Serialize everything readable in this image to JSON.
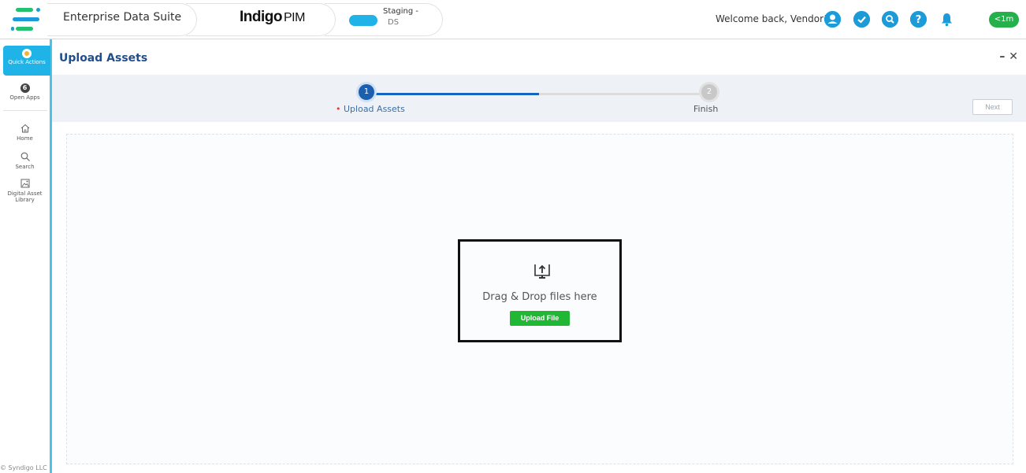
{
  "header": {
    "suite_name": "Enterprise Data Suite",
    "brand_main": "Indigo",
    "brand_suffix": "PIM",
    "env_line1": "Staging -",
    "env_line2": "DS",
    "welcome": "Welcome back, Vendor!",
    "time_badge": "<1m",
    "accent_color": "#1fb3e8",
    "badge_color": "#24b14b",
    "icons": [
      "user-icon",
      "check-icon",
      "search-icon",
      "help-icon",
      "bell-icon"
    ]
  },
  "sidebar": {
    "quick_actions": "Quick Actions",
    "open_apps_count": "6",
    "open_apps": "Open Apps",
    "items": [
      {
        "label": "Home",
        "icon": "home-icon"
      },
      {
        "label": "Search",
        "icon": "search-icon"
      },
      {
        "label": "Digital Asset Library",
        "icon": "image-icon"
      }
    ],
    "footer": "© Syndigo LLC"
  },
  "main": {
    "title": "Upload Assets",
    "minimize": "–",
    "close": "✕",
    "steps": [
      {
        "number": "1",
        "label": "Upload Assets",
        "state": "active"
      },
      {
        "number": "2",
        "label": "Finish",
        "state": "inactive"
      }
    ],
    "next_label": "Next",
    "drop_text": "Drag & Drop files here",
    "upload_label": "Upload File",
    "upload_color": "#1fb733",
    "step_color": "#1b5fae"
  }
}
